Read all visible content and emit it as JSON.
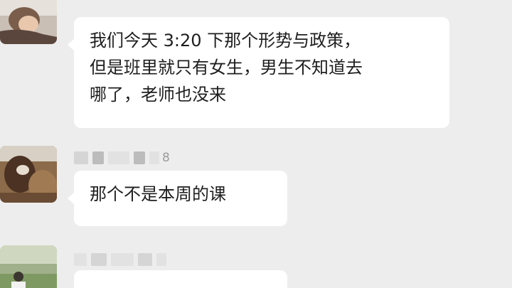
{
  "messages": [
    {
      "avatar_icon": "user-avatar-photo-person-lying",
      "lines": [
        "我们今天 3:20 下那个形势与政策，",
        "但是班里就只有女生，男生不知道去",
        "哪了，老师也没来"
      ]
    },
    {
      "avatar_icon": "user-avatar-photo-dog",
      "name_suffix": "8",
      "lines": [
        "那个不是本周的课"
      ]
    },
    {
      "avatar_icon": "user-avatar-photo-person-outdoors",
      "lines": []
    }
  ],
  "colors": {
    "background": "#ededed",
    "bubble": "#ffffff",
    "text": "#1e1e1e",
    "name_blur": "#d5d5d5"
  }
}
